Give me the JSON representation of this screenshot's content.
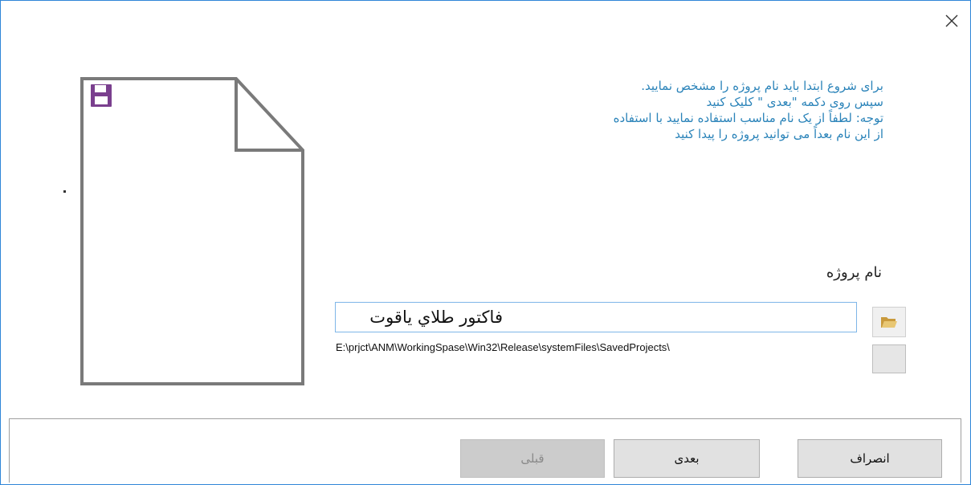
{
  "dialog": {
    "close_glyph": "✕",
    "instructions": [
      "برای شروع ابتدا باید نام پروژه را مشخص نمایید.",
      "سپس روی دکمه \"بعدی \" کلیک کنید",
      "توجه: لطفاً از یک نام مناسب استفاده نمایید با استفاده",
      "از این نام بعداً می توانید پروژه را پیدا کنید"
    ],
    "project_name_label": "نام پروژه",
    "project_name_value": "فاکتور طلاي ياقوت",
    "save_path": "E:\\prjct\\ANM\\WorkingSpase\\Win32\\Release\\systemFiles\\SavedProjects\\",
    "icons": {
      "save": "floppy-disk-icon",
      "folder": "folder-open-icon",
      "close": "close-icon"
    },
    "colors": {
      "instruction_text": "#2a83b9",
      "input_border": "#7fb6e8",
      "disk_icon": "#7a3f8e",
      "folder_icon": "#d9b45a"
    }
  },
  "footer": {
    "prev_label": "قبلی",
    "next_label": "بعدی",
    "cancel_label": "انصراف"
  }
}
